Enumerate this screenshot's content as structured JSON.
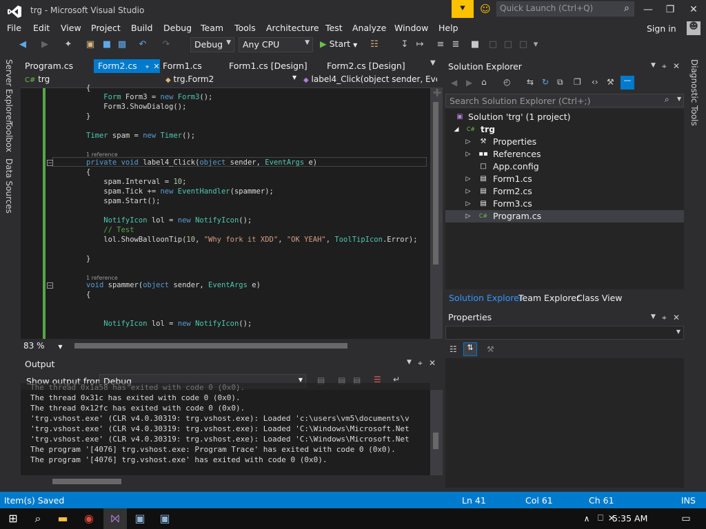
{
  "window": {
    "title": "trg - Microsoft Visual Studio",
    "quick_launch_placeholder": "Quick Launch (Ctrl+Q)"
  },
  "menu": [
    "File",
    "Edit",
    "View",
    "Project",
    "Build",
    "Debug",
    "Team",
    "Tools",
    "Architecture",
    "Test",
    "Analyze",
    "Window",
    "Help"
  ],
  "sign_in": "Sign in",
  "toolbar": {
    "config": "Debug",
    "platform": "Any CPU",
    "start": "Start"
  },
  "left_tools": [
    "Server Explorer",
    "Toolbox",
    "Data Sources"
  ],
  "right_tools": [
    "Diagnostic Tools"
  ],
  "doc_tabs": [
    "Program.cs",
    "Form2.cs",
    "Form1.cs",
    "Form1.cs [Design]",
    "Form2.cs [Design]"
  ],
  "active_tab": "Form2.cs",
  "nav": {
    "project": "trg",
    "type": "trg.Form2",
    "member": "label4_Click(object sender, Ever"
  },
  "editor": {
    "zoom": "83 %",
    "ref1": "1 reference",
    "ref2": "1 reference"
  },
  "output": {
    "title": "Output",
    "show_from_label": "Show output from:",
    "show_from_value": "Debug",
    "lines": [
      "The thread 0x1a58 has exited with code 0 (0x0).",
      "The thread 0x31c has exited with code 0 (0x0).",
      "The thread 0x12fc has exited with code 0 (0x0).",
      "'trg.vshost.exe' (CLR v4.0.30319: trg.vshost.exe): Loaded 'c:\\users\\vm5\\documents\\v",
      "'trg.vshost.exe' (CLR v4.0.30319: trg.vshost.exe): Loaded 'C:\\Windows\\Microsoft.Net",
      "'trg.vshost.exe' (CLR v4.0.30319: trg.vshost.exe): Loaded 'C:\\Windows\\Microsoft.Net",
      "The program '[4076] trg.vshost.exe: Program Trace' has exited with code 0 (0x0).",
      "The program '[4076] trg.vshost.exe' has exited with code 0 (0x0)."
    ]
  },
  "solution_explorer": {
    "title": "Solution Explorer",
    "search_placeholder": "Search Solution Explorer (Ctrl+;)",
    "solution": "Solution 'trg' (1 project)",
    "project": "trg",
    "items": [
      "Properties",
      "References",
      "App.config",
      "Form1.cs",
      "Form2.cs",
      "Form3.cs",
      "Program.cs"
    ],
    "tabs": [
      "Solution Explorer",
      "Team Explorer",
      "Class View"
    ]
  },
  "properties": {
    "title": "Properties"
  },
  "status": {
    "message": "Item(s) Saved",
    "ln": "Ln 41",
    "col": "Col 61",
    "ch": "Ch 61",
    "mode": "INS"
  },
  "taskbar": {
    "time": "5:35 AM"
  },
  "colors": {
    "accent": "#007acc",
    "background": "#2d2d30",
    "editor": "#1e1e1e",
    "notify": "#fcc200"
  }
}
